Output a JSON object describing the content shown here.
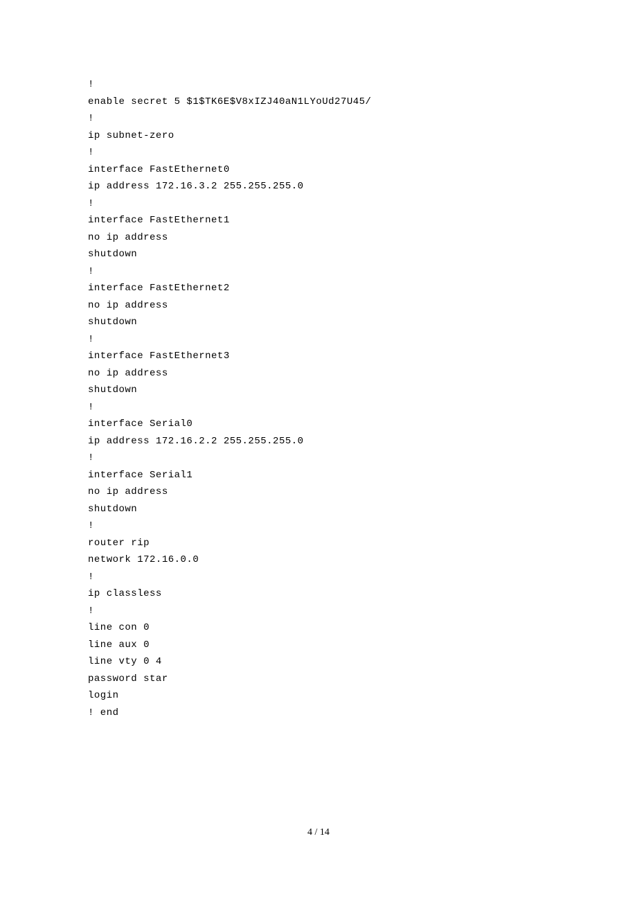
{
  "config": {
    "lines": [
      "!",
      "enable secret 5 $1$TK6E$V8xIZJ40aN1LYoUd27U45/",
      "!",
      "ip subnet-zero",
      "!",
      "interface FastEthernet0",
      "ip address 172.16.3.2 255.255.255.0",
      "!",
      "interface FastEthernet1",
      "no ip address",
      "shutdown",
      "!",
      "interface FastEthernet2",
      "no ip address",
      "shutdown",
      "!",
      "interface FastEthernet3",
      "no ip address",
      "shutdown",
      "!",
      "interface Serial0",
      "ip address 172.16.2.2 255.255.255.0",
      "!",
      "interface Serial1",
      "no ip address",
      "shutdown",
      "!",
      "router rip",
      "network 172.16.0.0",
      "!",
      "ip classless",
      "!",
      "line con 0",
      "line aux 0",
      "line vty 0 4",
      "password star",
      "login",
      "! end"
    ]
  },
  "footer": {
    "page_indicator": "4 / 14"
  }
}
